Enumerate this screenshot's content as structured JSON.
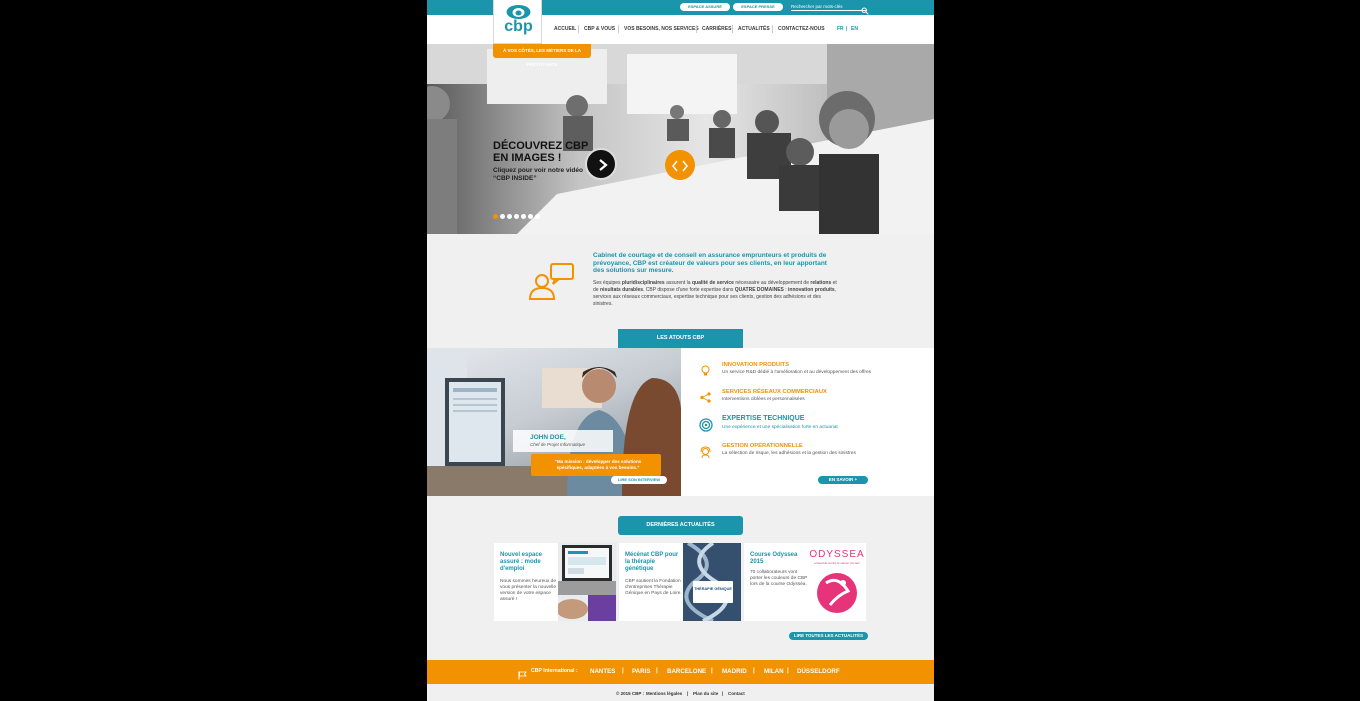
{
  "brand": {
    "logo_text": "cbp",
    "tagline": "À VOS CÔTÉS, LES MÉTIERS DE LA PRÉVOYANCE",
    "primary_color": "#1a95ab",
    "accent_color": "#f29200"
  },
  "topbar": {
    "espace_assure": "ESPACE ASSURÉ",
    "espace_presse": "ESPACE PRESSE",
    "search_placeholder": "Rechercher par mots-clés",
    "search_icon": "search-icon"
  },
  "nav": {
    "items": [
      "ACCUEIL",
      "CBP & VOUS",
      "VOS BESOINS, NOS SERVICES",
      "CARRIÈRES",
      "ACTUALITÉS",
      "CONTACTEZ-NOUS"
    ],
    "lang_fr": "FR",
    "lang_sep": "|",
    "lang_en": "EN"
  },
  "hero": {
    "title": "DÉCOUVREZ CBP EN IMAGES !",
    "subtitle": "Cliquez pour voir notre vidéo “CBP INSIDE”",
    "play_icon": "play-icon",
    "slider_icon": "chevron-left-right-icon",
    "slide_count": 7,
    "active_slide": 1
  },
  "intro": {
    "icon": "user-chat-icon",
    "title": "Cabinet de courtage et de conseil en assurance emprunteurs et produits de prévoyance, CBP est créateur de valeurs pour  ses clients, en leur apportant des solutions sur mesure.",
    "body_parts": {
      "a": "Ses équipes ",
      "b": "pluridisciplinaires",
      "c": " assurent la ",
      "d": "qualité de service",
      "e": " nécessaire au développement de ",
      "f": "relations",
      "g": " et de ",
      "h": "résultats durables",
      "i": ". CBP dispose d'une forte expertise dans ",
      "j": "QUATRE DOMAINES",
      "k": " : ",
      "l": "innovation produits",
      "m": ", services aux réseaux commerciaux, expertise technique pour ses clients, gestion des adhésions et des sinistres."
    }
  },
  "atouts": {
    "tab_label": "LES ATOUTS CBP",
    "person_name": "JOHN DOE,",
    "person_role": "Chef de Projet Informatique",
    "quote": "\"Ma mission : développer des solutions spécifiques, adaptées à vos besoins.\"",
    "interview_button": "LIRE SON INTERVIEW",
    "features": [
      {
        "title": "INNOVATION PRODUITS",
        "desc": "Un service R&D dédié à l'amélioration et au développement des offres",
        "icon": "lightbulb-icon"
      },
      {
        "title": "SERVICES RÉSEAUX COMMERCIAUX",
        "desc": "Interventions ciblées et personnalisées",
        "icon": "share-icon"
      },
      {
        "title": "EXPERTISE TECHNIQUE",
        "desc": "Une expérience et une spécialisation forte en actuariat",
        "icon": "target-icon"
      },
      {
        "title": "GESTION OPÉRATIONNELLE",
        "desc": "La sélection de risque, les adhésions et la gestion des sinistres",
        "icon": "headset-icon"
      }
    ],
    "more_button": "EN SAVOIR +"
  },
  "news": {
    "tab_label": "DERNIÈRES ACTUALITÉS",
    "cards": [
      {
        "title": "Nouvel espace assuré : mode d'emploi",
        "text": "Nous sommes heureux de vous présenter la nouvelle version de votre espace assuré !"
      },
      {
        "title": "Mécénat CBP pour la thérapie génétique",
        "text": "CBP soutient la Fondation d'entreprises Thérapie Génique en Pays de Loire.",
        "badge": "THÉRAPIE GÉNIQUE"
      },
      {
        "title": "Course Odyssea 2015",
        "text": "70 collaborateurs vont porter les couleurs de CBP lors de la course Odysséa.",
        "logo_text": "ODYSSEA",
        "logo_sub": "ensemble contre le cancer du sein"
      }
    ],
    "all_button": "LIRE TOUTES LES ACTUALITÉS"
  },
  "footer": {
    "flag_icon": "flag-icon",
    "intl_label": "CBP International :",
    "cities": [
      "NANTES",
      "PARIS",
      "BARCELONE",
      "MADRID",
      "MILAN",
      "DÜSSELDORF"
    ],
    "sep": "|",
    "copyright": "© 2015 CBP :",
    "legal": "Mentions légales",
    "sitemap": "Plan du site",
    "contact": "Contact"
  }
}
